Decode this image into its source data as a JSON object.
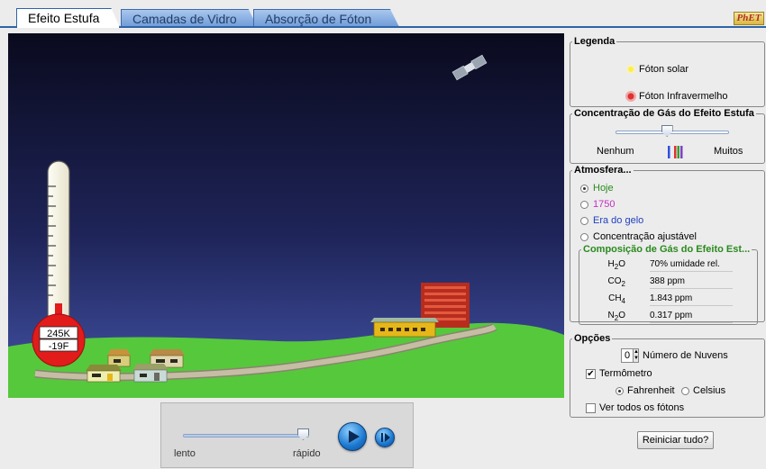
{
  "tabs": [
    {
      "label": "Efeito Estufa",
      "active": true
    },
    {
      "label": "Camadas de Vidro",
      "active": false
    },
    {
      "label": "Absorção de Fóton",
      "active": false
    }
  ],
  "logo": "PhET",
  "thermometer": {
    "kelvin": "245K",
    "fahrenheit": "-19F"
  },
  "speed": {
    "slow_label": "lento",
    "fast_label": "rápido",
    "value": 0.95
  },
  "legend": {
    "title": "Legenda",
    "items": [
      {
        "label": "Fóton solar",
        "icon": "sun-photon-icon",
        "color": "#ffee44"
      },
      {
        "label": "Fóton Infravermelho",
        "icon": "infrared-photon-icon",
        "color": "#e03030"
      }
    ]
  },
  "concentration": {
    "title": "Concentração de Gás do Efeito Estufa",
    "min_label": "Nenhum",
    "max_label": "Muitos",
    "value": 0.45
  },
  "atmosphere": {
    "title": "Atmosfera...",
    "options": [
      {
        "label": "Hoje",
        "selected": true,
        "color": "#2a8a1e"
      },
      {
        "label": "1750",
        "selected": false,
        "color": "#c030c0"
      },
      {
        "label": "Era do gelo",
        "selected": false,
        "color": "#2040c0"
      },
      {
        "label": "Concentração ajustável",
        "selected": false,
        "color": "#000000"
      }
    ]
  },
  "composition": {
    "title": "Composição de Gás do Efeito Est...",
    "rows": [
      {
        "base": "H",
        "sub": "2",
        "tail": "O",
        "value": "70% umidade rel."
      },
      {
        "base": "CO",
        "sub": "2",
        "tail": "",
        "value": "388 ppm"
      },
      {
        "base": "CH",
        "sub": "4",
        "tail": "",
        "value": "1.843 ppm"
      },
      {
        "base": "N",
        "sub": "2",
        "tail": "O",
        "value": "0.317 ppm"
      }
    ]
  },
  "options": {
    "title": "Opções",
    "clouds_value": "0",
    "clouds_label": "Número de Nuvens",
    "thermometer_label": "Termômetro",
    "thermometer_checked": true,
    "fahrenheit_label": "Fahrenheit",
    "celsius_label": "Celsius",
    "unit_selected": "Fahrenheit",
    "all_photons_label": "Ver todos os fótons",
    "all_photons_checked": false
  },
  "reset_label": "Reiniciar tudo?",
  "colors": {
    "sky_top": "#0a0a1e",
    "sky_bottom": "#3a4a9a",
    "ground": "#56c83c",
    "road": "#b0a58a"
  }
}
